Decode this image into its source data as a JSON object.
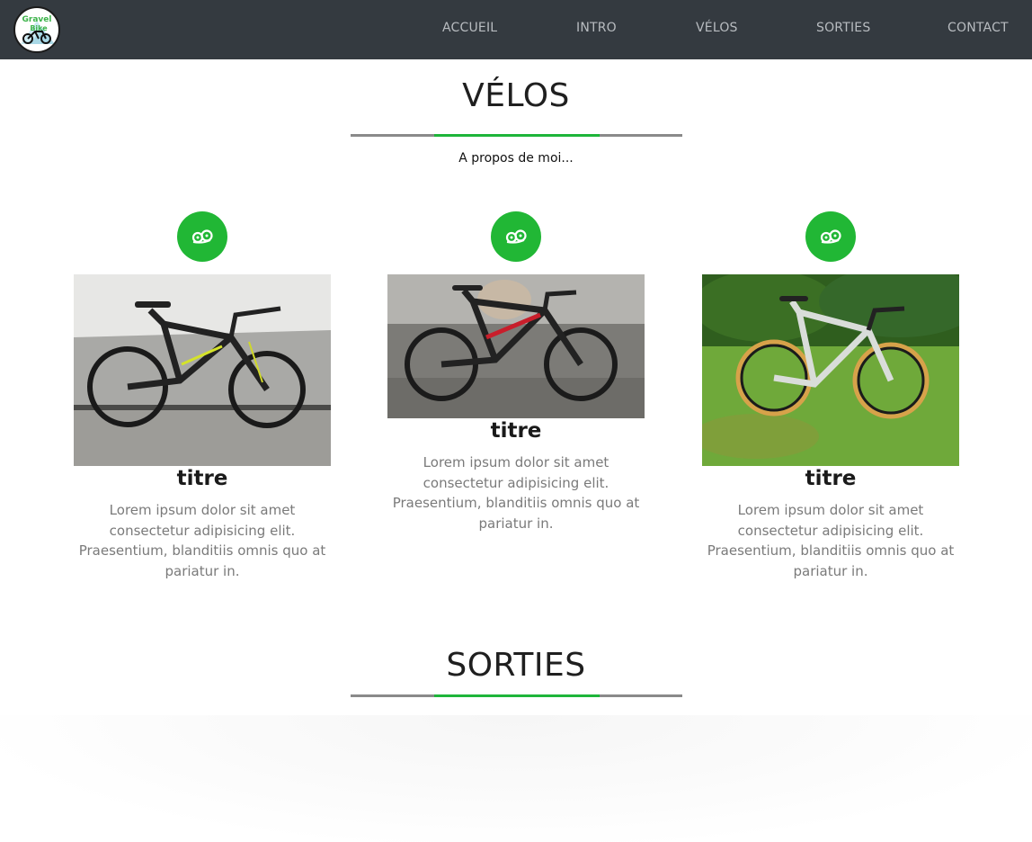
{
  "nav": {
    "logo_text_top": "Gravel",
    "logo_text_bottom": "Bike",
    "links": [
      "ACCUEIL",
      "INTRO",
      "VÉLOS",
      "SORTIES",
      "CONTACT"
    ]
  },
  "velos": {
    "title": "VÉLOS",
    "subtitle": "A propos de moi...",
    "cards": [
      {
        "icon": "bike-gears-icon",
        "photo": "black mountain bike with yellow accents",
        "title": "titre",
        "text": "Lorem ipsum dolor sit amet consectetur adipisicing elit. Praesentium, blanditiis omnis quo at pariatur in."
      },
      {
        "icon": "bike-gears-icon",
        "photo": "black and red mountain bike",
        "title": "titre",
        "text": "Lorem ipsum dolor sit amet consectetur adipisicing elit. Praesentium, blanditiis omnis quo at pariatur in."
      },
      {
        "icon": "bike-gears-icon",
        "photo": "white gravel bike on grass",
        "title": "titre",
        "text": "Lorem ipsum dolor sit amet consectetur adipisicing elit. Praesentium, blanditiis omnis quo at pariatur in."
      }
    ]
  },
  "sorties": {
    "title": "SORTIES"
  },
  "colors": {
    "navbar": "#343a40",
    "accent": "#21b735",
    "divider": "#8a8a8a",
    "body_text": "#7a7a7a"
  }
}
